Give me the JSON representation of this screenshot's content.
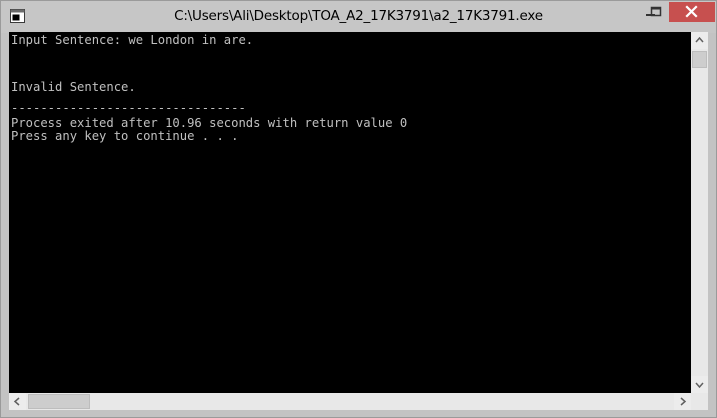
{
  "window": {
    "title": "C:\\Users\\Ali\\Desktop\\TOA_A2_17K3791\\a2_17K3791.exe",
    "title_bar_color": "#c6c6c6",
    "close_button_color": "#c7504f",
    "icons": {
      "app": "console-app-icon",
      "minimize": "minimize-icon",
      "maximize": "maximize-icon",
      "close": "close-icon"
    }
  },
  "console": {
    "background": "#000000",
    "text_color": "#c0c0c0",
    "lines": [
      "Input Sentence: we London in are.",
      "",
      "",
      "Invalid Sentence.",
      "",
      "--------------------------------",
      "Process exited after 10.96 seconds with return value 0",
      "Press any key to continue . . ."
    ]
  },
  "scrollbars": {
    "vertical_icons": {
      "up": "scroll-up-arrow-icon",
      "down": "scroll-down-arrow-icon"
    },
    "horizontal_icons": {
      "left": "scroll-left-arrow-icon",
      "right": "scroll-right-arrow-icon"
    }
  }
}
